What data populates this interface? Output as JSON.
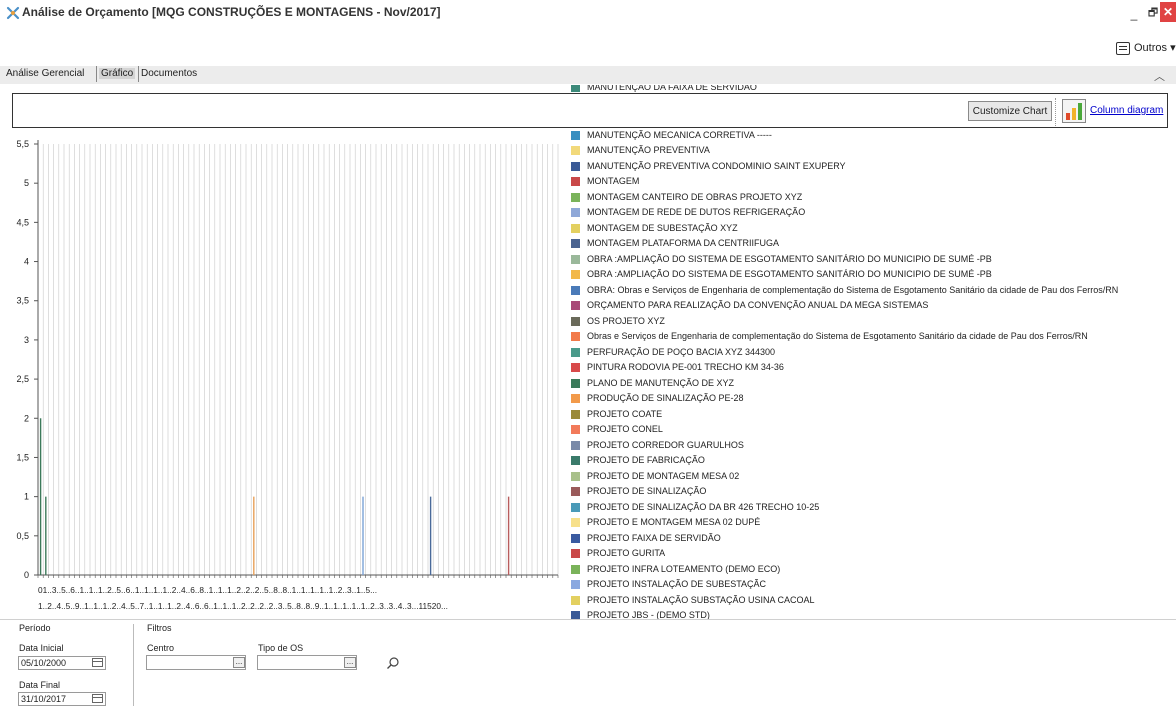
{
  "window": {
    "title": "Análise de Orçamento [MQG CONSTRUÇÕES E MONTAGENS - Nov/2017]",
    "minimize": "_",
    "maximize": "🗗",
    "close": "✕"
  },
  "toolbar": {
    "outros_label": "Outros"
  },
  "tabs": [
    {
      "label": "Análise Gerencial",
      "selected": false
    },
    {
      "label": "Gráfico",
      "selected": true
    },
    {
      "label": "Documentos",
      "selected": false
    }
  ],
  "chart_controls": {
    "customize_label": "Customize Chart",
    "chart_type_label": "Column diagram"
  },
  "chart_data": {
    "type": "bar",
    "ylim": [
      0,
      5.5
    ],
    "yticks": [
      "5,5",
      "5",
      "4,5",
      "4",
      "3,5",
      "3",
      "2,5",
      "2",
      "1,5",
      "1",
      "0,5",
      "0"
    ],
    "x_tick_row1": "01..3..5..6..1..1..1..2..5..6..1..1..1..1..2..4..6..8..1..1..1..2..2..2..5..8..8..1..1..1..1..1..2..3..1..5...",
    "x_tick_row2": "1..2..4..5..9..1..1..1..2..4..5..7..1..1..1..2..4..6..6..1..1..1..2..2..2..2..3..5..8..8..9..1..1..1..1..1..2..3..3..4..3...11520...",
    "category_count": 100,
    "bars": [
      {
        "index": 0,
        "value": 2,
        "color": "#3c7a5a"
      },
      {
        "index": 1,
        "value": 1,
        "color": "#3c7a5a"
      },
      {
        "index": 41,
        "value": 1,
        "color": "#e8a15a"
      },
      {
        "index": 62,
        "value": 1,
        "color": "#7aa2d6"
      },
      {
        "index": 75,
        "value": 1,
        "color": "#4a6a9a"
      },
      {
        "index": 90,
        "value": 1,
        "color": "#b85c5c"
      }
    ]
  },
  "legend": [
    {
      "label": "MANUTENÇÃO DA FAIXA DE SERVIDÃO",
      "color": "#3c8a7a"
    },
    {
      "label": "MANUTENÇÃO MECANICA CORRETIVA -----",
      "color": "#3a8fc0"
    },
    {
      "label": "MANUTENÇÃO PREVENTIVA",
      "color": "#f2d97a"
    },
    {
      "label": "MANUTENÇÃO PREVENTIVA CONDOMINIO SAINT EXUPERY",
      "color": "#3a5a96"
    },
    {
      "label": "MONTAGEM",
      "color": "#c94848"
    },
    {
      "label": "MONTAGEM CANTEIRO DE OBRAS PROJETO XYZ",
      "color": "#7ab35a"
    },
    {
      "label": "MONTAGEM DE REDE DE DUTOS REFRIGERAÇÃO",
      "color": "#8fa8d8"
    },
    {
      "label": "MONTAGEM DE SUBESTAÇÃO XYZ",
      "color": "#e3d060"
    },
    {
      "label": "MONTAGEM PLATAFORMA DA CENTRIIFUGA",
      "color": "#4a6390"
    },
    {
      "label": "OBRA :AMPLIAÇÃO DO SISTEMA DE ESGOTAMENTO SANITÁRIO DO MUNICIPIO DE SUMÉ -PB",
      "color": "#9ab89a"
    },
    {
      "label": "OBRA :AMPLIAÇÃO DO SISTEMA DE ESGOTAMENTO SANITÁRIO DO MUNICIPIO DE SUMÉ -PB",
      "color": "#f2b84a"
    },
    {
      "label": "OBRA: Obras e Serviços de Engenharia de complementação do Sistema de Esgotamento Sanitário da cidade de Pau dos Ferros/RN",
      "color": "#4a7ab8"
    },
    {
      "label": "ORÇAMENTO PARA REALIZAÇÃO DA CONVENÇÃO ANUAL DA MEGA SISTEMAS",
      "color": "#a84a78"
    },
    {
      "label": "OS PROJETO XYZ",
      "color": "#6a6a5a"
    },
    {
      "label": "Obras e Serviços de Engenharia de complementação do Sistema de Esgotamento Sanitário da cidade de Pau dos Ferros/RN",
      "color": "#f27a4a"
    },
    {
      "label": "PERFURAÇÃO DE POÇO BACIA XYZ 344300",
      "color": "#4a9a8a"
    },
    {
      "label": "PINTURA RODOVIA PE-001 TRECHO KM 34-36",
      "color": "#d84a4a"
    },
    {
      "label": "PLANO DE MANUTENÇÃO DE XYZ",
      "color": "#3a7a5a"
    },
    {
      "label": "PRODUÇÃO DE SINALIZAÇÃO PE-28",
      "color": "#f29a4a"
    },
    {
      "label": "PROJETO COATE",
      "color": "#9a8a3a"
    },
    {
      "label": "PROJETO CONEL",
      "color": "#f27a5a"
    },
    {
      "label": "PROJETO CORREDOR GUARULHOS",
      "color": "#7a8aa8"
    },
    {
      "label": "PROJETO DE FABRICAÇÃO",
      "color": "#3a7a6a"
    },
    {
      "label": "PROJETO DE MONTAGEM MESA 02",
      "color": "#a8c08a"
    },
    {
      "label": "PROJETO DE SINALIZAÇÃO",
      "color": "#9a5a5a"
    },
    {
      "label": "PROJETO DE SINALIZAÇÃO DA BR 426 TRECHO 10-25",
      "color": "#4a9ab8"
    },
    {
      "label": "PROJETO E MONTAGEM MESA 02 DUPÉ",
      "color": "#f7e08a"
    },
    {
      "label": "PROJETO FAIXA DE SERVIDÃO",
      "color": "#3a5aa0"
    },
    {
      "label": "PROJETO GURITA",
      "color": "#c94848"
    },
    {
      "label": "PROJETO INFRA LOTEAMENTO (DEMO ECO)",
      "color": "#7ab35a"
    },
    {
      "label": "PROJETO INSTALAÇÃO DE SUBESTAÇÃC",
      "color": "#8aa8e0"
    },
    {
      "label": "PROJETO INSTALAÇÃO SUBSTAÇÃO USINA CACOAL",
      "color": "#e3d060"
    },
    {
      "label": "PROJETO JBS - (DEMO STD)",
      "color": "#3a5a96"
    }
  ],
  "filters": {
    "periodo_title": "Período",
    "filtros_title": "Filtros",
    "data_inicial_label": "Data Inicial",
    "data_inicial_value": "05/10/2000",
    "data_final_label": "Data Final",
    "data_final_value": "31/10/2017",
    "centro_label": "Centro",
    "centro_value": "",
    "tipo_os_label": "Tipo de OS",
    "tipo_os_value": "",
    "lookup_btn": "...",
    "search_icon": "search-icon"
  }
}
